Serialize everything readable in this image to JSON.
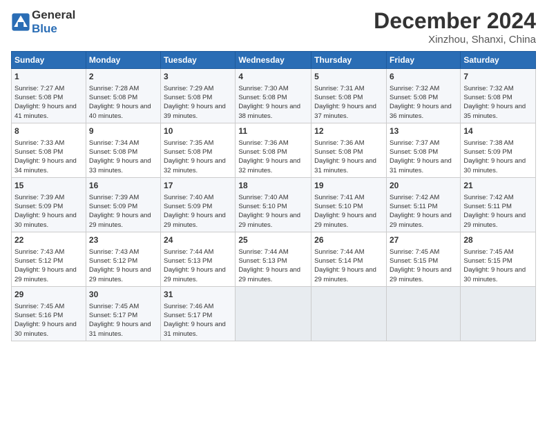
{
  "logo": {
    "text_general": "General",
    "text_blue": "Blue"
  },
  "title": "December 2024",
  "location": "Xinzhou, Shanxi, China",
  "header_days": [
    "Sunday",
    "Monday",
    "Tuesday",
    "Wednesday",
    "Thursday",
    "Friday",
    "Saturday"
  ],
  "weeks": [
    [
      {
        "day": "1",
        "sunrise": "7:27 AM",
        "sunset": "5:08 PM",
        "daylight": "9 hours and 41 minutes."
      },
      {
        "day": "2",
        "sunrise": "7:28 AM",
        "sunset": "5:08 PM",
        "daylight": "9 hours and 40 minutes."
      },
      {
        "day": "3",
        "sunrise": "7:29 AM",
        "sunset": "5:08 PM",
        "daylight": "9 hours and 39 minutes."
      },
      {
        "day": "4",
        "sunrise": "7:30 AM",
        "sunset": "5:08 PM",
        "daylight": "9 hours and 38 minutes."
      },
      {
        "day": "5",
        "sunrise": "7:31 AM",
        "sunset": "5:08 PM",
        "daylight": "9 hours and 37 minutes."
      },
      {
        "day": "6",
        "sunrise": "7:32 AM",
        "sunset": "5:08 PM",
        "daylight": "9 hours and 36 minutes."
      },
      {
        "day": "7",
        "sunrise": "7:32 AM",
        "sunset": "5:08 PM",
        "daylight": "9 hours and 35 minutes."
      }
    ],
    [
      {
        "day": "8",
        "sunrise": "7:33 AM",
        "sunset": "5:08 PM",
        "daylight": "9 hours and 34 minutes."
      },
      {
        "day": "9",
        "sunrise": "7:34 AM",
        "sunset": "5:08 PM",
        "daylight": "9 hours and 33 minutes."
      },
      {
        "day": "10",
        "sunrise": "7:35 AM",
        "sunset": "5:08 PM",
        "daylight": "9 hours and 32 minutes."
      },
      {
        "day": "11",
        "sunrise": "7:36 AM",
        "sunset": "5:08 PM",
        "daylight": "9 hours and 32 minutes."
      },
      {
        "day": "12",
        "sunrise": "7:36 AM",
        "sunset": "5:08 PM",
        "daylight": "9 hours and 31 minutes."
      },
      {
        "day": "13",
        "sunrise": "7:37 AM",
        "sunset": "5:08 PM",
        "daylight": "9 hours and 31 minutes."
      },
      {
        "day": "14",
        "sunrise": "7:38 AM",
        "sunset": "5:09 PM",
        "daylight": "9 hours and 30 minutes."
      }
    ],
    [
      {
        "day": "15",
        "sunrise": "7:39 AM",
        "sunset": "5:09 PM",
        "daylight": "9 hours and 30 minutes."
      },
      {
        "day": "16",
        "sunrise": "7:39 AM",
        "sunset": "5:09 PM",
        "daylight": "9 hours and 29 minutes."
      },
      {
        "day": "17",
        "sunrise": "7:40 AM",
        "sunset": "5:09 PM",
        "daylight": "9 hours and 29 minutes."
      },
      {
        "day": "18",
        "sunrise": "7:40 AM",
        "sunset": "5:10 PM",
        "daylight": "9 hours and 29 minutes."
      },
      {
        "day": "19",
        "sunrise": "7:41 AM",
        "sunset": "5:10 PM",
        "daylight": "9 hours and 29 minutes."
      },
      {
        "day": "20",
        "sunrise": "7:42 AM",
        "sunset": "5:11 PM",
        "daylight": "9 hours and 29 minutes."
      },
      {
        "day": "21",
        "sunrise": "7:42 AM",
        "sunset": "5:11 PM",
        "daylight": "9 hours and 29 minutes."
      }
    ],
    [
      {
        "day": "22",
        "sunrise": "7:43 AM",
        "sunset": "5:12 PM",
        "daylight": "9 hours and 29 minutes."
      },
      {
        "day": "23",
        "sunrise": "7:43 AM",
        "sunset": "5:12 PM",
        "daylight": "9 hours and 29 minutes."
      },
      {
        "day": "24",
        "sunrise": "7:44 AM",
        "sunset": "5:13 PM",
        "daylight": "9 hours and 29 minutes."
      },
      {
        "day": "25",
        "sunrise": "7:44 AM",
        "sunset": "5:13 PM",
        "daylight": "9 hours and 29 minutes."
      },
      {
        "day": "26",
        "sunrise": "7:44 AM",
        "sunset": "5:14 PM",
        "daylight": "9 hours and 29 minutes."
      },
      {
        "day": "27",
        "sunrise": "7:45 AM",
        "sunset": "5:15 PM",
        "daylight": "9 hours and 29 minutes."
      },
      {
        "day": "28",
        "sunrise": "7:45 AM",
        "sunset": "5:15 PM",
        "daylight": "9 hours and 30 minutes."
      }
    ],
    [
      {
        "day": "29",
        "sunrise": "7:45 AM",
        "sunset": "5:16 PM",
        "daylight": "9 hours and 30 minutes."
      },
      {
        "day": "30",
        "sunrise": "7:45 AM",
        "sunset": "5:17 PM",
        "daylight": "9 hours and 31 minutes."
      },
      {
        "day": "31",
        "sunrise": "7:46 AM",
        "sunset": "5:17 PM",
        "daylight": "9 hours and 31 minutes."
      },
      null,
      null,
      null,
      null
    ]
  ],
  "labels": {
    "sunrise": "Sunrise:",
    "sunset": "Sunset:",
    "daylight": "Daylight:"
  }
}
